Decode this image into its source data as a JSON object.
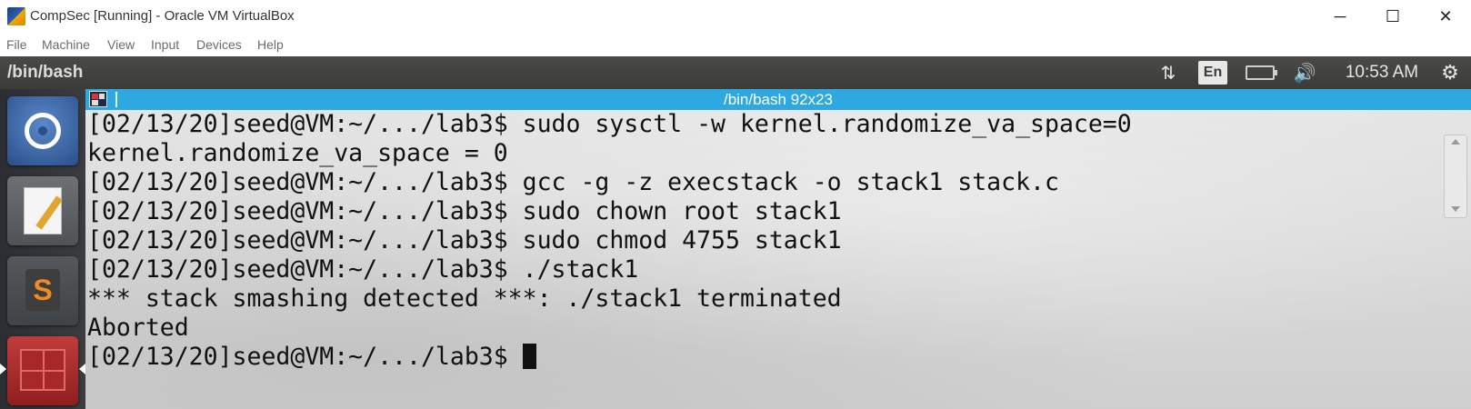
{
  "window": {
    "title": "CompSec [Running] - Oracle VM VirtualBox",
    "app_icon": "virtualbox-icon",
    "controls": {
      "minimize": "─",
      "maximize": "☐",
      "close": "✕"
    }
  },
  "menubar": {
    "items": [
      "File",
      "Machine",
      "View",
      "Input",
      "Devices",
      "Help"
    ]
  },
  "ubuntu_panel": {
    "title": "/bin/bash",
    "indicators": {
      "network_icon": "⇅",
      "language": "En",
      "battery_icon": "battery-icon",
      "sound_icon": "🔊",
      "clock": "10:53 AM",
      "settings_icon": "⚙"
    }
  },
  "launcher": {
    "items": [
      "ubuntu-dash",
      "text-editor",
      "sublime-text",
      "terminal"
    ],
    "sublime_letter": "S"
  },
  "terminal": {
    "title": "/bin/bash 92x23",
    "lines": [
      "[02/13/20]seed@VM:~/.../lab3$ sudo sysctl -w kernel.randomize_va_space=0",
      "kernel.randomize_va_space = 0",
      "[02/13/20]seed@VM:~/.../lab3$ gcc -g -z execstack -o stack1 stack.c",
      "[02/13/20]seed@VM:~/.../lab3$ sudo chown root stack1",
      "[02/13/20]seed@VM:~/.../lab3$ sudo chmod 4755 stack1",
      "[02/13/20]seed@VM:~/.../lab3$ ./stack1",
      "*** stack smashing detected ***: ./stack1 terminated",
      "Aborted",
      "[02/13/20]seed@VM:~/.../lab3$ "
    ]
  },
  "colors": {
    "terminal_titlebar": "#2ea8e0",
    "panel_background": "#3b3b38",
    "terminal_text": "#111111"
  }
}
